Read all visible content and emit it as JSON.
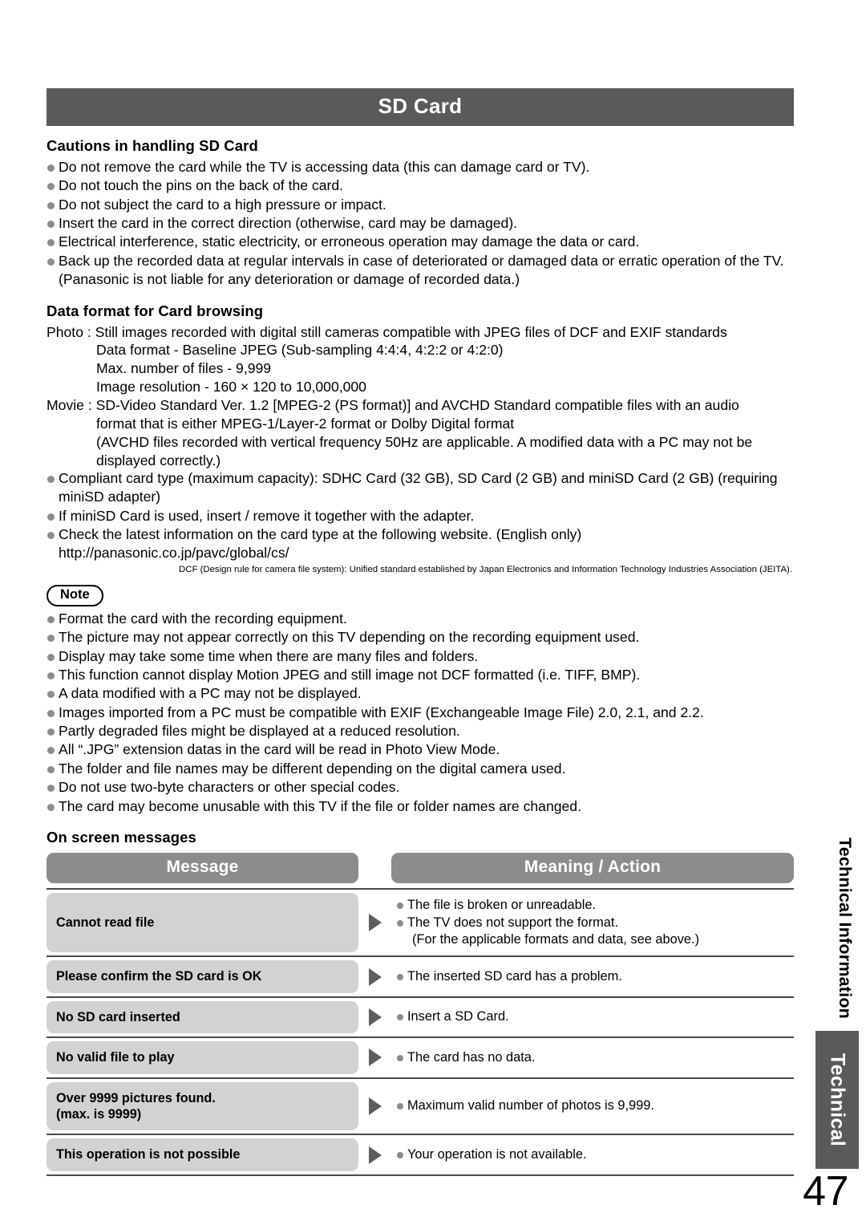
{
  "section": {
    "title": "SD Card"
  },
  "cautions": {
    "heading": "Cautions in handling SD Card",
    "items": [
      "Do not remove the card while the TV is accessing data (this can damage card or TV).",
      "Do not touch the pins on the back of the card.",
      "Do not subject the card to a high pressure or impact.",
      "Insert the card in the correct direction (otherwise, card may be damaged).",
      "Electrical interference, static electricity, or erroneous operation may damage the data or card.",
      "Back up the recorded data at regular intervals in case of deteriorated or damaged data or erratic operation of the TV. (Panasonic is not liable for any deterioration or damage of recorded data.)"
    ]
  },
  "dataformat": {
    "heading": "Data format for Card browsing",
    "photo": {
      "lead": "Photo : Still images recorded with digital still cameras compatible with JPEG files of DCF   and EXIF standards",
      "lines": [
        "Data format - Baseline JPEG (Sub-sampling 4:4:4, 4:2:2 or 4:2:0)",
        "Max. number of files - 9,999",
        "Image resolution - 160 × 120 to 10,000,000"
      ]
    },
    "movie": {
      "lead": "Movie : SD-Video Standard Ver. 1.2 [MPEG-2 (PS format)] and AVCHD Standard compatible files with an audio",
      "lines": [
        "format that is either MPEG-1/Layer-2 format or Dolby Digital format",
        "(AVCHD files recorded with vertical frequency 50Hz are applicable. A modified data with a PC may not be",
        "displayed correctly.)"
      ]
    },
    "bullets": [
      "Compliant card type (maximum capacity): SDHC Card (32 GB), SD Card (2 GB) and miniSD Card (2 GB) (requiring miniSD adapter)",
      "If miniSD Card is used, insert / remove it together with the adapter.",
      "Check the latest information on the card type at the following website. (English only)"
    ],
    "url": "http://panasonic.co.jp/pavc/global/cs/",
    "footnote": "DCF (Design rule for camera file system): Unified standard established by Japan Electronics and Information Technology Industries Association (JEITA)."
  },
  "note": {
    "label": "Note",
    "items": [
      "Format the card with the recording equipment.",
      "The picture may not appear correctly on this TV depending on the recording equipment used.",
      "Display may take some time when there are many files and folders.",
      "This function cannot display Motion JPEG and still image not DCF formatted (i.e. TIFF, BMP).",
      "A data modified with a PC may not be displayed.",
      "Images imported from a PC must be compatible with EXIF (Exchangeable Image File) 2.0, 2.1, and 2.2.",
      "Partly degraded files might be displayed at a reduced resolution.",
      "All “.JPG” extension datas in the card will be read in Photo View Mode.",
      "The folder and file names may be different depending on the digital camera used.",
      "Do not use two-byte characters or other special codes.",
      "The card may become unusable with this TV if the file or folder names are changed."
    ]
  },
  "onscreen": {
    "heading": "On screen messages",
    "columns": {
      "message": "Message",
      "action": "Meaning / Action"
    },
    "rows": [
      {
        "message": "Cannot read file",
        "actions": [
          "The file is broken or unreadable.",
          "The TV does not support the format."
        ],
        "subnote": "(For the applicable formats and data, see above.)"
      },
      {
        "message": "Please confirm the SD card is OK",
        "actions": [
          "The inserted SD card has a problem."
        ],
        "subnote": ""
      },
      {
        "message": "No SD card inserted",
        "actions": [
          "Insert a SD Card."
        ],
        "subnote": ""
      },
      {
        "message": "No valid file to play",
        "actions": [
          "The card has no data."
        ],
        "subnote": ""
      },
      {
        "message": "Over 9999 pictures found.\n(max. is 9999)",
        "actions": [
          "Maximum valid number of photos is 9,999."
        ],
        "subnote": ""
      },
      {
        "message": "This operation is not possible",
        "actions": [
          "Your operation is not available."
        ],
        "subnote": ""
      }
    ]
  },
  "sidebar": {
    "chapter_label": "Technical Information",
    "tab_label": "Technical"
  },
  "page_number": "47",
  "colors": {
    "title_bar": "#5a5a5a",
    "table_header": "#8c8c8c",
    "message_cell": "#d2d2d2",
    "bullet": "#8c8c8c",
    "arrow": "#5e5e5e",
    "rule": "#4a4a4a"
  }
}
